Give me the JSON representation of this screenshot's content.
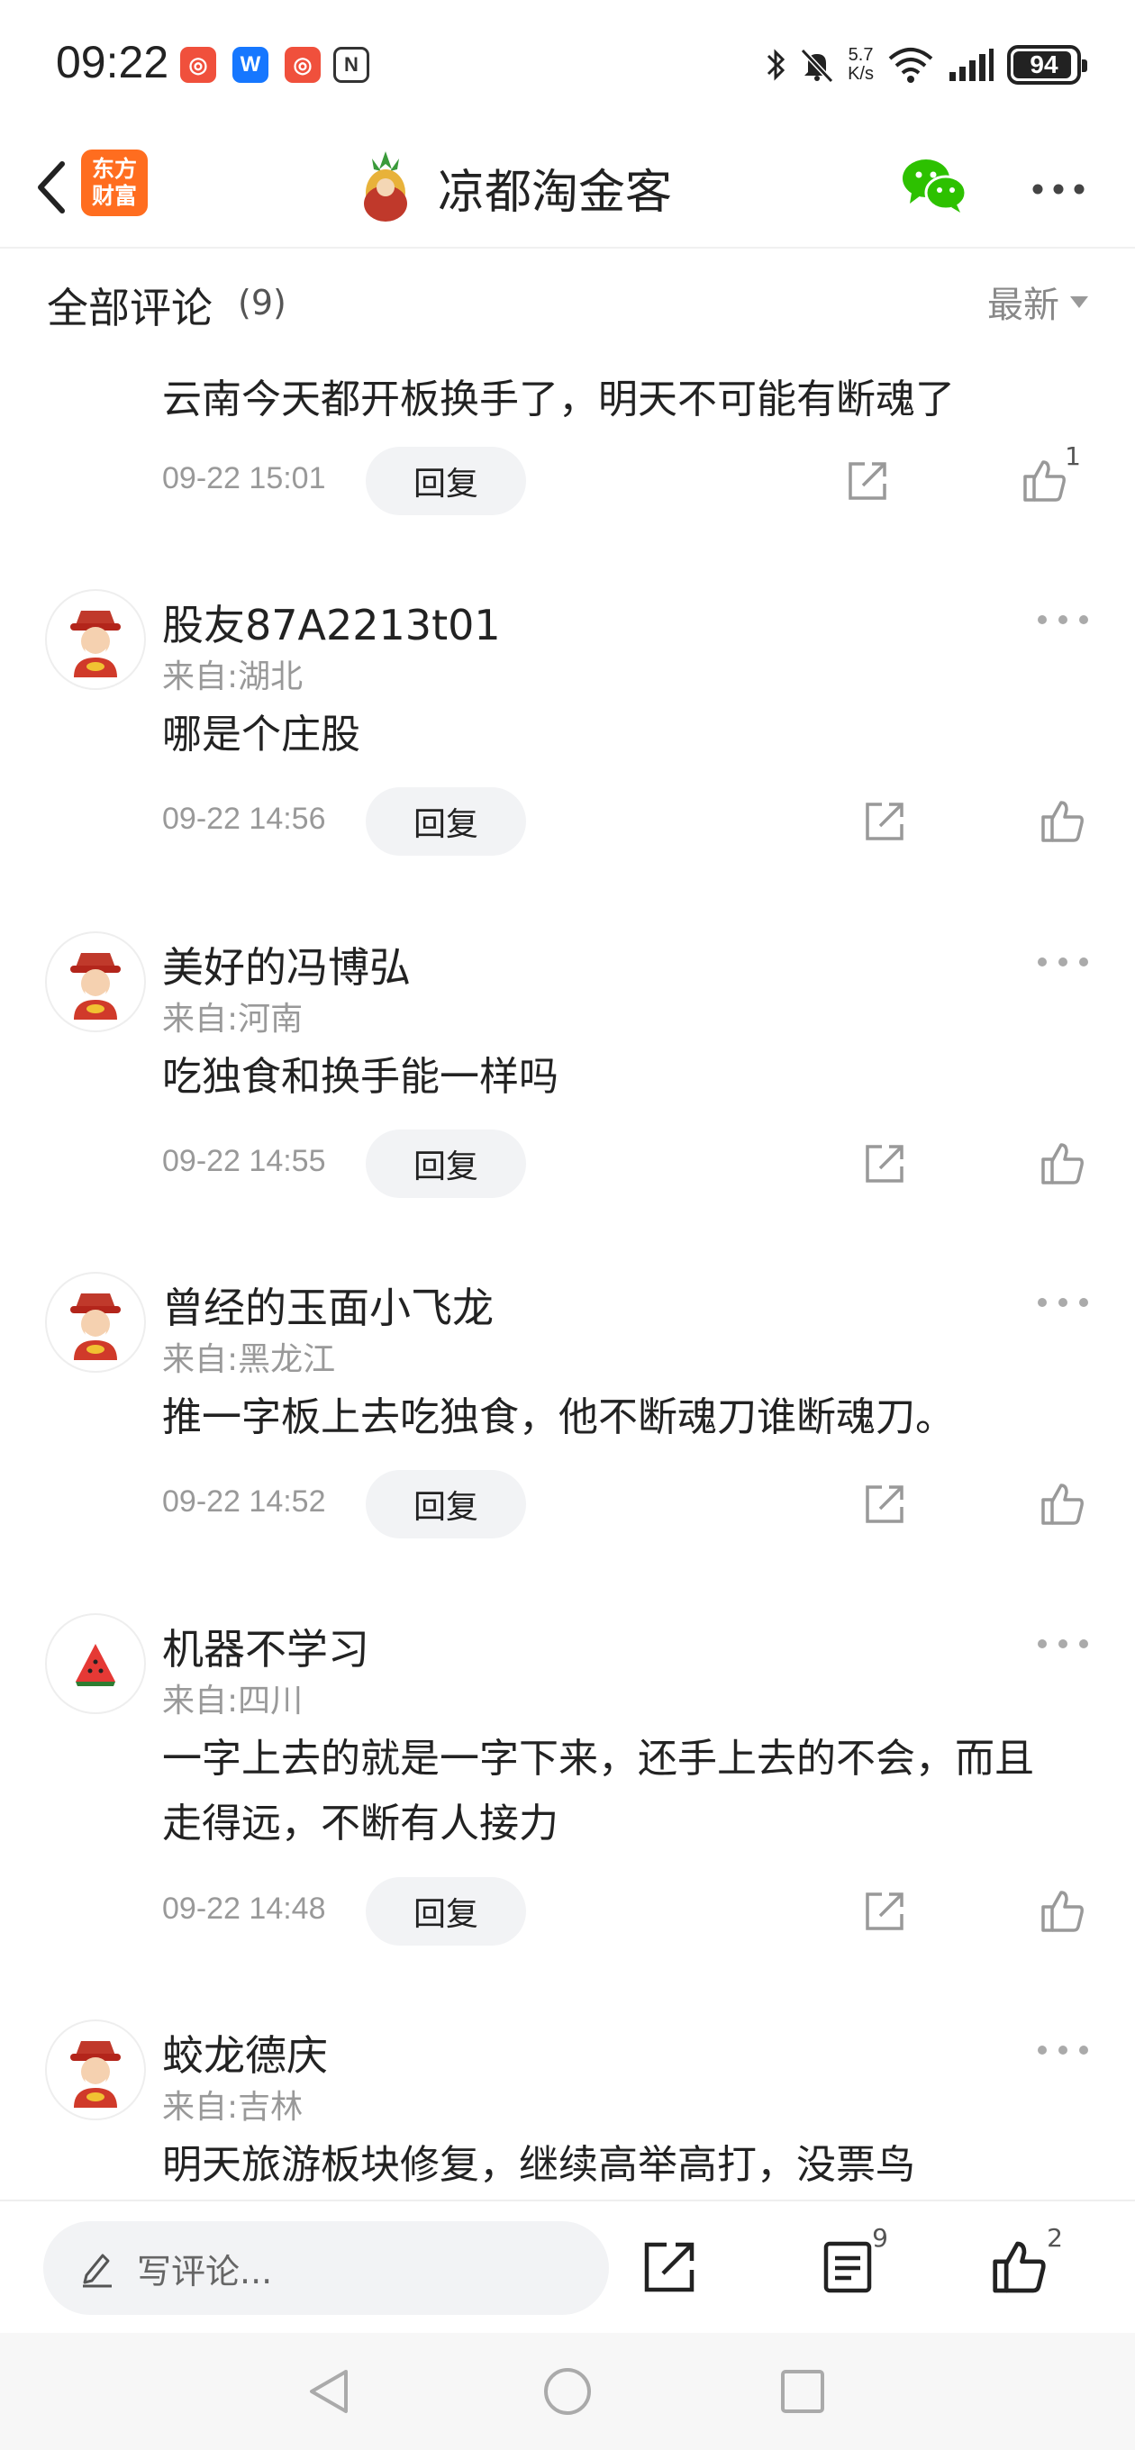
{
  "status_bar": {
    "time": "09:22",
    "net_speed_value": "5.7",
    "net_speed_unit": "K/s",
    "battery": "94",
    "battery_level": 0.94
  },
  "header": {
    "brand_line1": "东方",
    "brand_line2": "财富",
    "author_name": "凉都淘金客"
  },
  "section": {
    "title": "全部评论",
    "count": "(9)",
    "sort": "最新"
  },
  "comments": [
    {
      "text": "云南今天都开板换手了，明天不可能有断魂了",
      "date": "09-22 15:01",
      "reply": "回复",
      "likes": "1"
    },
    {
      "username": "股友87A2213t01",
      "location": "来自:湖北",
      "text": "哪是个庄股",
      "date": "09-22 14:56",
      "reply": "回复"
    },
    {
      "username": "美好的冯博弘",
      "location": "来自:河南",
      "text": "吃独食和换手能一样吗",
      "date": "09-22 14:55",
      "reply": "回复"
    },
    {
      "username": "曾经的玉面小飞龙",
      "location": "来自:黑龙江",
      "text": "推一字板上去吃独食，他不断魂刀谁断魂刀。",
      "date": "09-22 14:52",
      "reply": "回复"
    },
    {
      "username": "机器不学习",
      "location": "来自:四川",
      "text": "一字上去的就是一字下来，还手上去的不会，而且走得远，不断有人接力",
      "date": "09-22 14:48",
      "reply": "回复"
    },
    {
      "username": "蛟龙德庆",
      "location": "来自:吉林",
      "text": "明天旅游板块修复，继续高举高打，没票鸟"
    }
  ],
  "bottom_bar": {
    "write_placeholder": "写评论...",
    "comment_count": "9",
    "like_count": "2"
  },
  "icons": {
    "back": "back-arrow-icon",
    "wechat": "wechat-icon",
    "more": "more-icon",
    "share": "share-icon",
    "like": "thumbs-up-icon",
    "pen": "pen-icon",
    "comments": "comment-list-icon"
  },
  "colors": {
    "brand": "#ff6d1f",
    "wechat": "#2dc100",
    "reply_bg": "#f2f3f5",
    "muted_text": "#999999"
  }
}
